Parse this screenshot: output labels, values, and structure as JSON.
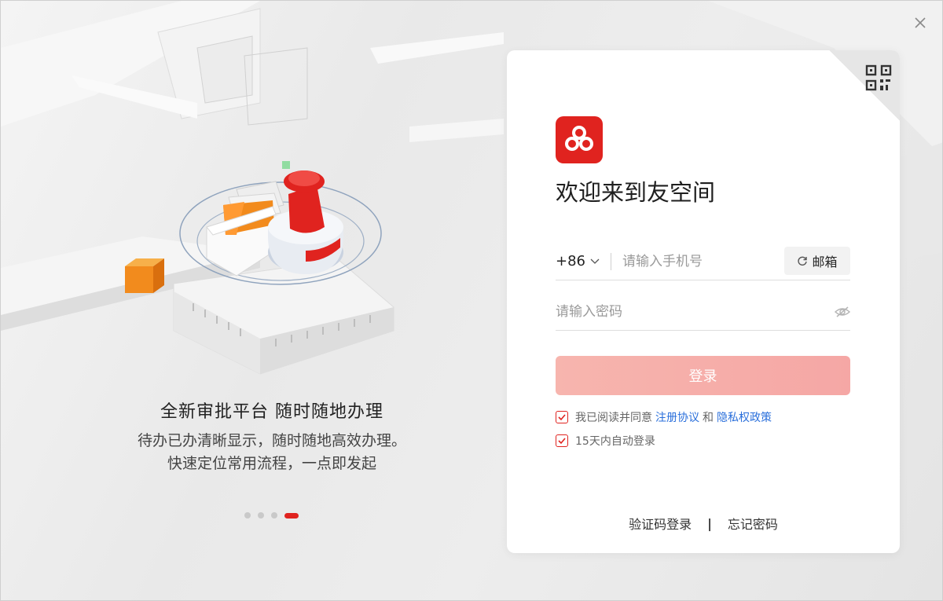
{
  "window": {
    "close_label": "×"
  },
  "left": {
    "slogan_title": "全新审批平台  随时随地办理",
    "slogan_line1": "待办已办清晰显示，随时随地高效办理。",
    "slogan_line2": "快速定位常用流程，一点即发起",
    "carousel": {
      "count": 4,
      "active_index": 3
    }
  },
  "login": {
    "welcome": "欢迎来到友空间",
    "country_code": "+86",
    "phone_placeholder": "请输入手机号",
    "switch_label": "邮箱",
    "password_placeholder": "请输入密码",
    "submit_label": "登录",
    "agree_prefix": "我已阅读并同意",
    "agree_link1": "注册协议",
    "agree_and": "和",
    "agree_link2": "隐私权政策",
    "auto_login": "15天内自动登录",
    "sms_login": "验证码登录",
    "separator": "|",
    "forgot": "忘记密码"
  },
  "icons": {
    "close": "close-icon",
    "qr": "qrcode-icon",
    "logo": "app-logo",
    "dropdown": "chevron-down-icon",
    "switch": "refresh-icon",
    "eye": "eye-hidden-icon",
    "check": "check-icon"
  },
  "colors": {
    "brand": "#e0231f",
    "button_disabled": "#f7b5ae",
    "link": "#2a6fdb"
  }
}
